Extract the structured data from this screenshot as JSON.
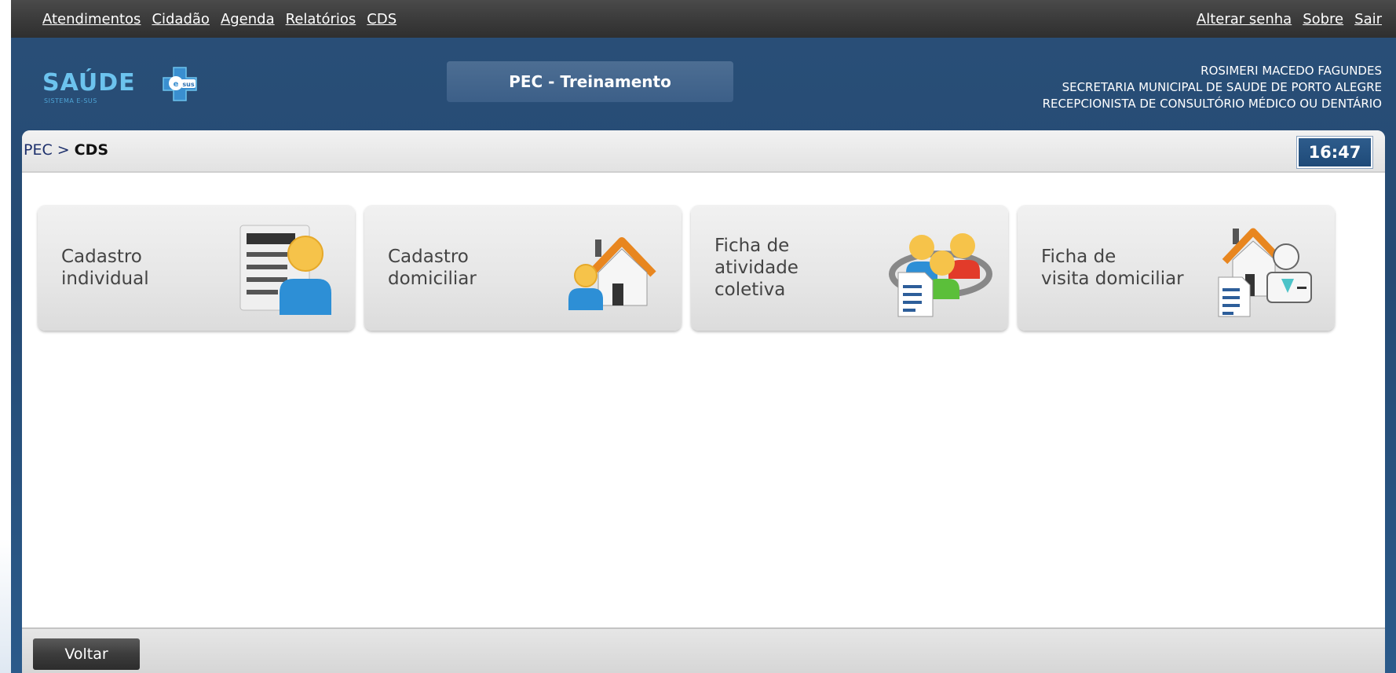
{
  "topnav": {
    "left_links": [
      "Atendimentos",
      "Cidadão",
      "Agenda",
      "Relatórios",
      "CDS"
    ],
    "right_links": [
      "Alterar senha",
      "Sobre",
      "Sair"
    ]
  },
  "header": {
    "logo_text": "SAÚDE",
    "logo_badge": "sus",
    "logo_sub": "SISTEMA E-SUS",
    "environment": "PEC - Treinamento",
    "user_name": "ROSIMERI MACEDO FAGUNDES",
    "user_org": "SECRETARIA MUNICIPAL DE SAUDE DE PORTO ALEGRE",
    "user_role": "RECEPCIONISTA DE CONSULTÓRIO MÉDICO OU DENTÁRIO"
  },
  "breadcrumb": {
    "root": "PEC",
    "separator": ">",
    "current": "CDS"
  },
  "clock": "16:47",
  "tiles": [
    {
      "label": "Cadastro\nindividual",
      "icon": "person-id-card-icon"
    },
    {
      "label": "Cadastro\ndomiciliar",
      "icon": "person-house-icon"
    },
    {
      "label": "Ficha de\natividade\ncoletiva",
      "icon": "group-document-icon"
    },
    {
      "label": "Ficha de\nvisita domiciliar",
      "icon": "house-visit-document-icon"
    }
  ],
  "footer": {
    "back_label": "Voltar"
  },
  "colors": {
    "header_bg": "#244a73",
    "nav_bg": "#3a3a3a",
    "clock_bg": "#1e4a78",
    "tile_bg": "#e6e6e6"
  }
}
